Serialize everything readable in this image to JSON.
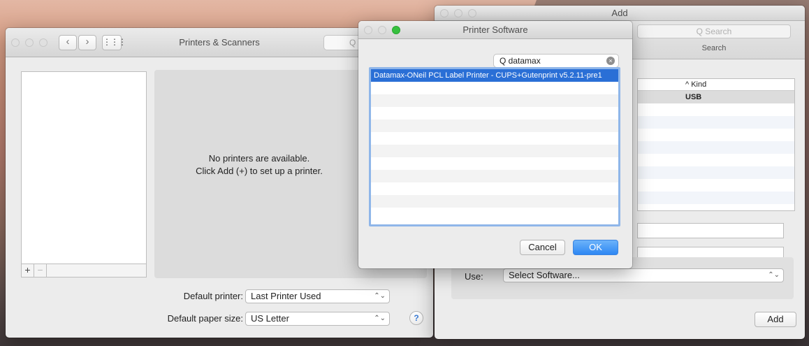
{
  "printers_scanners": {
    "title": "Printers & Scanners",
    "nav_back": "‹",
    "nav_forward": "›",
    "grid_icon": "⋮⋮⋮",
    "search_placeholder": "Q",
    "empty_line1": "No printers are available.",
    "empty_line2": "Click Add (+) to set up a printer.",
    "add_label": "+",
    "remove_label": "−",
    "default_printer_label": "Default printer:",
    "default_printer_value": "Last Printer Used",
    "paper_size_label": "Default paper size:",
    "paper_size_value": "US Letter",
    "help_label": "?"
  },
  "add_window": {
    "title": "Add",
    "search_placeholder": "Q Search",
    "search_caption": "Search",
    "kind_header": "^ Kind",
    "kind_row": "USB",
    "use_label": "Use:",
    "use_value": "Select Software...",
    "add_button": "Add"
  },
  "printer_software": {
    "title": "Printer Software",
    "search_value": "Q datamax",
    "clear_icon": "×",
    "items": [
      "Datamax-ONeil PCL Label Printer - CUPS+Gutenprint v5.2.11-pre1"
    ],
    "cancel_label": "Cancel",
    "ok_label": "OK"
  }
}
